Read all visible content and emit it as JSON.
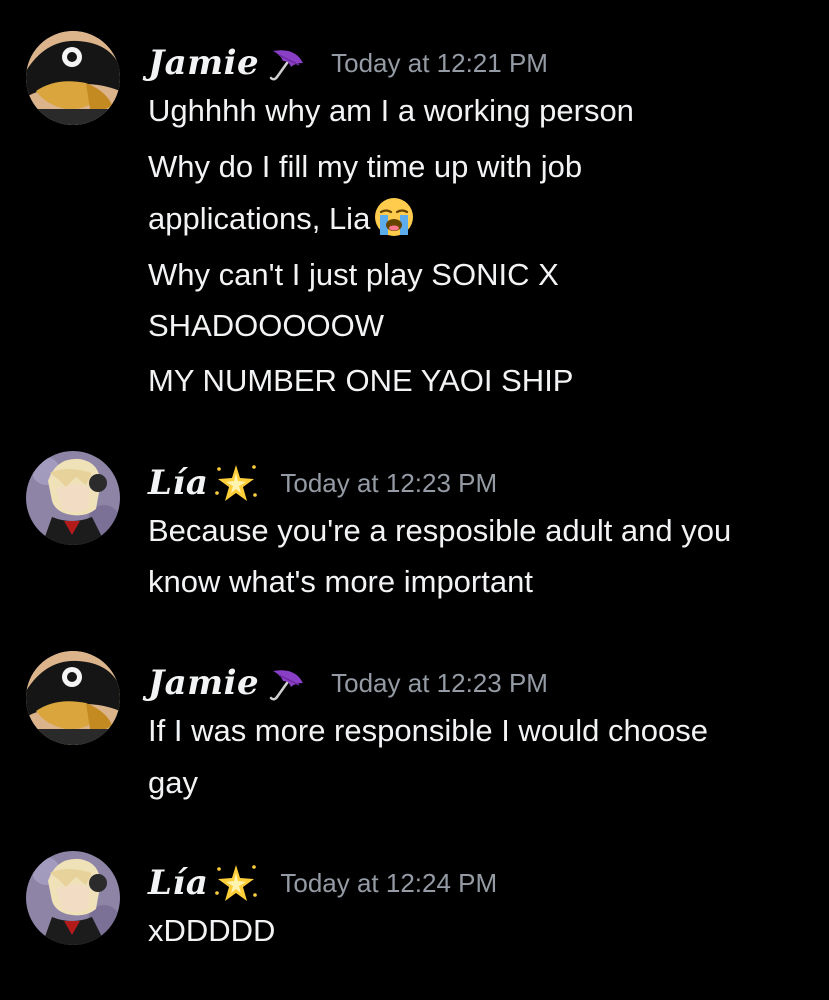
{
  "colors": {
    "background": "#000000",
    "text": "#f2f3f5",
    "timestamp": "#949ba4"
  },
  "messages": [
    {
      "author": "Jamie",
      "author_icon": "umbrella-icon",
      "timestamp": "Today at 12:21 PM",
      "lines": [
        "Ughhhh why am I a working person",
        "Why do I fill my time up with job",
        "applications, Lia",
        "Why can't I just play SONIC X",
        "SHADOOOOOW",
        "MY NUMBER ONE YAOI SHIP"
      ],
      "inline_emoji": "loudly-crying-face-icon"
    },
    {
      "author": "Lía",
      "author_icon": "sparkle-star-icon",
      "timestamp": "Today at 12:23 PM",
      "lines": [
        "Because you're a resposible adult and you",
        "know what's more important"
      ]
    },
    {
      "author": "Jamie",
      "author_icon": "umbrella-icon",
      "timestamp": "Today at 12:23 PM",
      "lines": [
        "If I was more responsible I would choose",
        "gay"
      ]
    },
    {
      "author": "Lía",
      "author_icon": "sparkle-star-icon",
      "timestamp": "Today at 12:24 PM",
      "lines": [
        "xDDDDD"
      ]
    }
  ]
}
